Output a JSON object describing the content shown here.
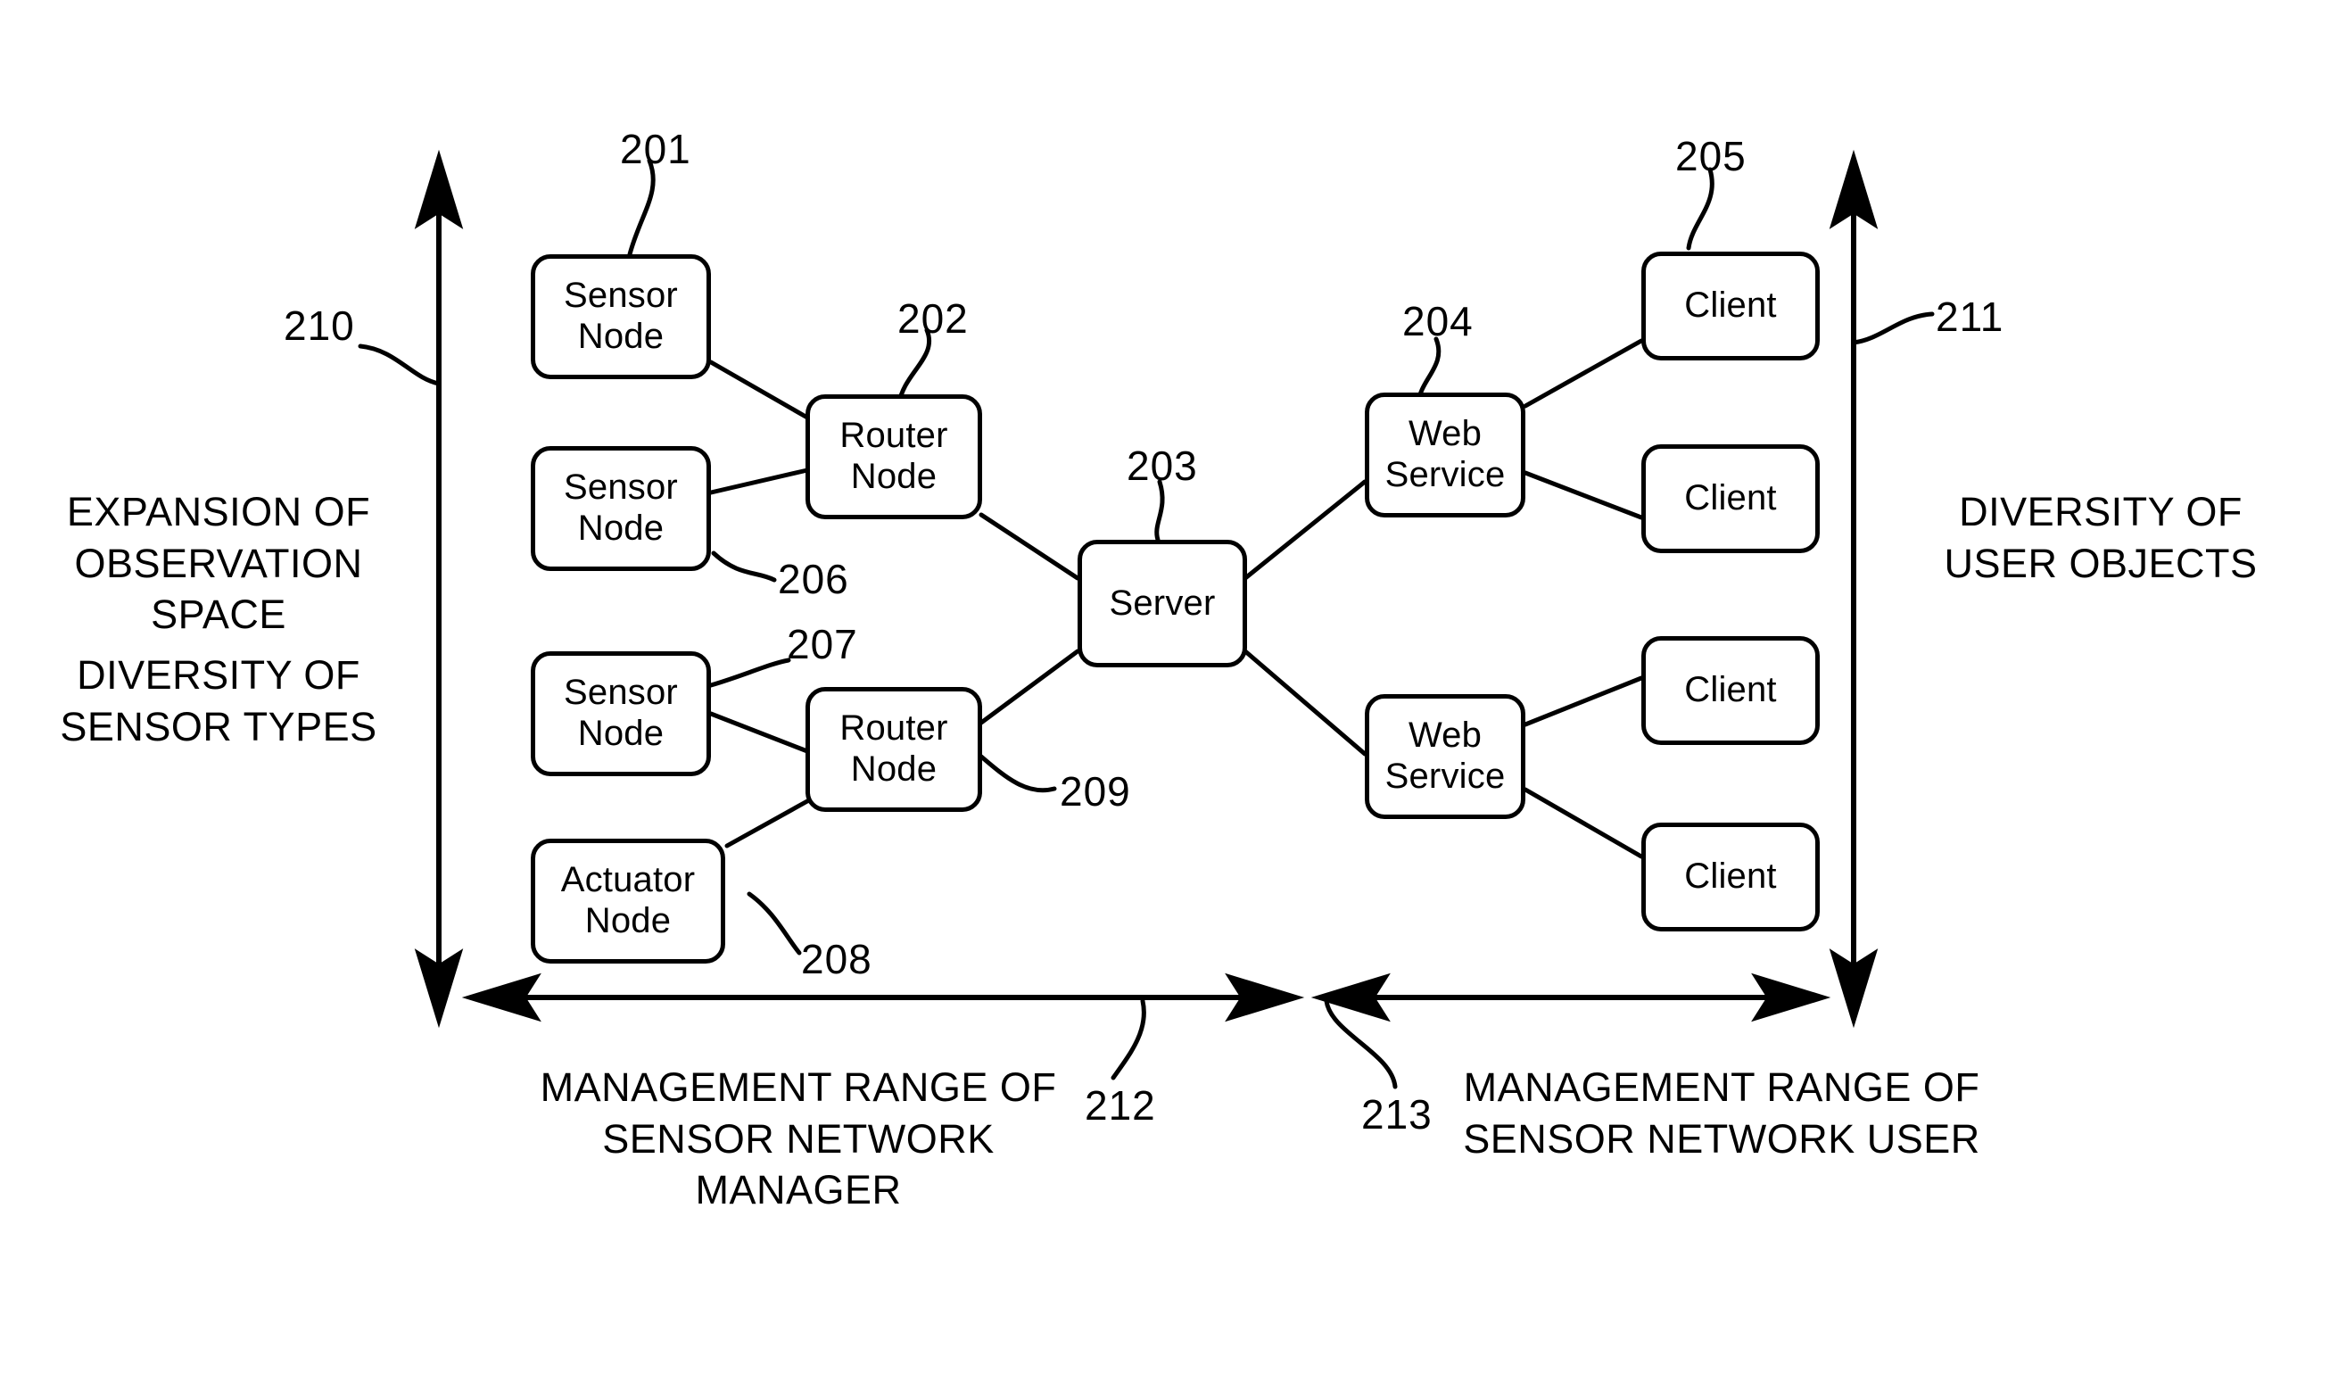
{
  "figure": {
    "type": "patent-block-diagram",
    "background_color": "#ffffff",
    "line_color": "#000000"
  },
  "nodes": [
    {
      "id": "sensor_node_1",
      "label": "Sensor\nNode",
      "ref": "201"
    },
    {
      "id": "sensor_node_2",
      "label": "Sensor\nNode",
      "ref": "206"
    },
    {
      "id": "sensor_node_3",
      "label": "Sensor\nNode",
      "ref": "207"
    },
    {
      "id": "actuator_node",
      "label": "Actuator\nNode",
      "ref": "208"
    },
    {
      "id": "router_node_1",
      "label": "Router\nNode",
      "ref": "202"
    },
    {
      "id": "router_node_2",
      "label": "Router\nNode",
      "ref": "209"
    },
    {
      "id": "server",
      "label": "Server",
      "ref": "203"
    },
    {
      "id": "web_service_1",
      "label": "Web\nService",
      "ref": "204"
    },
    {
      "id": "web_service_2",
      "label": "Web\nService",
      "ref": ""
    },
    {
      "id": "client_1",
      "label": "Client",
      "ref": "205"
    },
    {
      "id": "client_2",
      "label": "Client",
      "ref": ""
    },
    {
      "id": "client_3",
      "label": "Client",
      "ref": ""
    },
    {
      "id": "client_4",
      "label": "Client",
      "ref": ""
    }
  ],
  "node_labels": {
    "sensor_node_1_line1": "Sensor",
    "sensor_node_1_line2": "Node",
    "sensor_node_2_line1": "Sensor",
    "sensor_node_2_line2": "Node",
    "sensor_node_3_line1": "Sensor",
    "sensor_node_3_line2": "Node",
    "actuator_node_line1": "Actuator",
    "actuator_node_line2": "Node",
    "router_node_1_line1": "Router",
    "router_node_1_line2": "Node",
    "router_node_2_line1": "Router",
    "router_node_2_line2": "Node",
    "server": "Server",
    "web_service_1_line1": "Web",
    "web_service_1_line2": "Service",
    "web_service_2_line1": "Web",
    "web_service_2_line2": "Service",
    "client_1": "Client",
    "client_2": "Client",
    "client_3": "Client",
    "client_4": "Client"
  },
  "reference_numerals": {
    "n201": "201",
    "n202": "202",
    "n203": "203",
    "n204": "204",
    "n205": "205",
    "n206": "206",
    "n207": "207",
    "n208": "208",
    "n209": "209",
    "n210": "210",
    "n211": "211",
    "n212": "212",
    "n213": "213"
  },
  "captions": {
    "left_top": "EXPANSION OF\nOBSERVATION SPACE",
    "left_bottom": "DIVERSITY OF\nSENSOR TYPES",
    "right": "DIVERSITY OF\nUSER OBJECTS",
    "bottom_left": "MANAGEMENT RANGE OF\nSENSOR NETWORK MANAGER",
    "bottom_right": "MANAGEMENT RANGE OF\nSENSOR NETWORK USER"
  },
  "axes": {
    "left_vertical_arrow": {
      "ref": "210",
      "direction": "double-vertical"
    },
    "right_vertical_arrow": {
      "ref": "211",
      "direction": "double-vertical"
    },
    "bottom_left_arrow": {
      "ref": "212",
      "direction": "double-horizontal"
    },
    "bottom_right_arrow": {
      "ref": "213",
      "direction": "double-horizontal"
    }
  },
  "connections": [
    {
      "from": "sensor_node_1",
      "to": "router_node_1"
    },
    {
      "from": "sensor_node_2",
      "to": "router_node_1"
    },
    {
      "from": "router_node_1",
      "to": "server"
    },
    {
      "from": "sensor_node_3",
      "to": "router_node_2"
    },
    {
      "from": "actuator_node",
      "to": "router_node_2"
    },
    {
      "from": "router_node_2",
      "to": "server"
    },
    {
      "from": "server",
      "to": "web_service_1"
    },
    {
      "from": "server",
      "to": "web_service_2"
    },
    {
      "from": "web_service_1",
      "to": "client_1"
    },
    {
      "from": "web_service_1",
      "to": "client_2"
    },
    {
      "from": "web_service_2",
      "to": "client_3"
    },
    {
      "from": "web_service_2",
      "to": "client_4"
    }
  ]
}
